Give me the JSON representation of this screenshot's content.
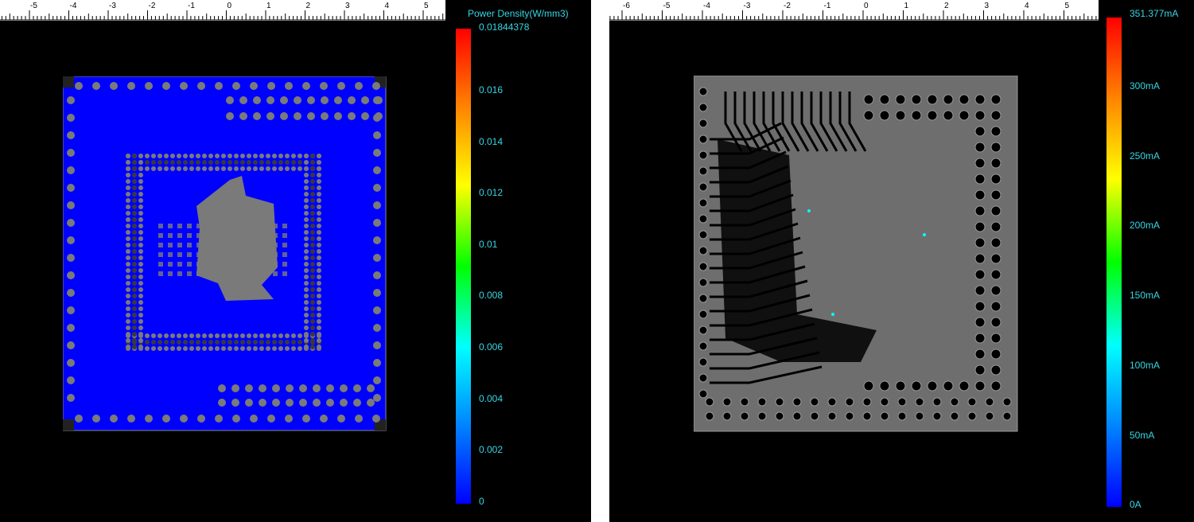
{
  "left_view": {
    "ruler_labels": [
      "-5",
      "-4",
      "-3",
      "-2",
      "-1",
      "0",
      "1",
      "2",
      "3",
      "4",
      "5"
    ],
    "colorbar": {
      "title": "Power Density(W/mm3)",
      "labels": [
        "0.01844378",
        "0.016",
        "0.014",
        "0.012",
        "0.01",
        "0.008",
        "0.006",
        "0.004",
        "0.002",
        "0"
      ]
    },
    "colors": {
      "fill": "#0000ff",
      "copper": "#7a7a7a",
      "dark": "#3a3a3a"
    }
  },
  "right_view": {
    "ruler_labels": [
      "-6",
      "-5",
      "-4",
      "-3",
      "-2",
      "-1",
      "0",
      "1",
      "2",
      "3",
      "4",
      "5"
    ],
    "colorbar": {
      "labels": [
        "351.377mA",
        "300mA",
        "250mA",
        "200mA",
        "150mA",
        "100mA",
        "50mA",
        "0A"
      ]
    },
    "colors": {
      "fill": "#6e6e6e",
      "trace": "#000000",
      "highlight": "#00ffff"
    }
  },
  "colorbar_label_color": "#36d6e3"
}
